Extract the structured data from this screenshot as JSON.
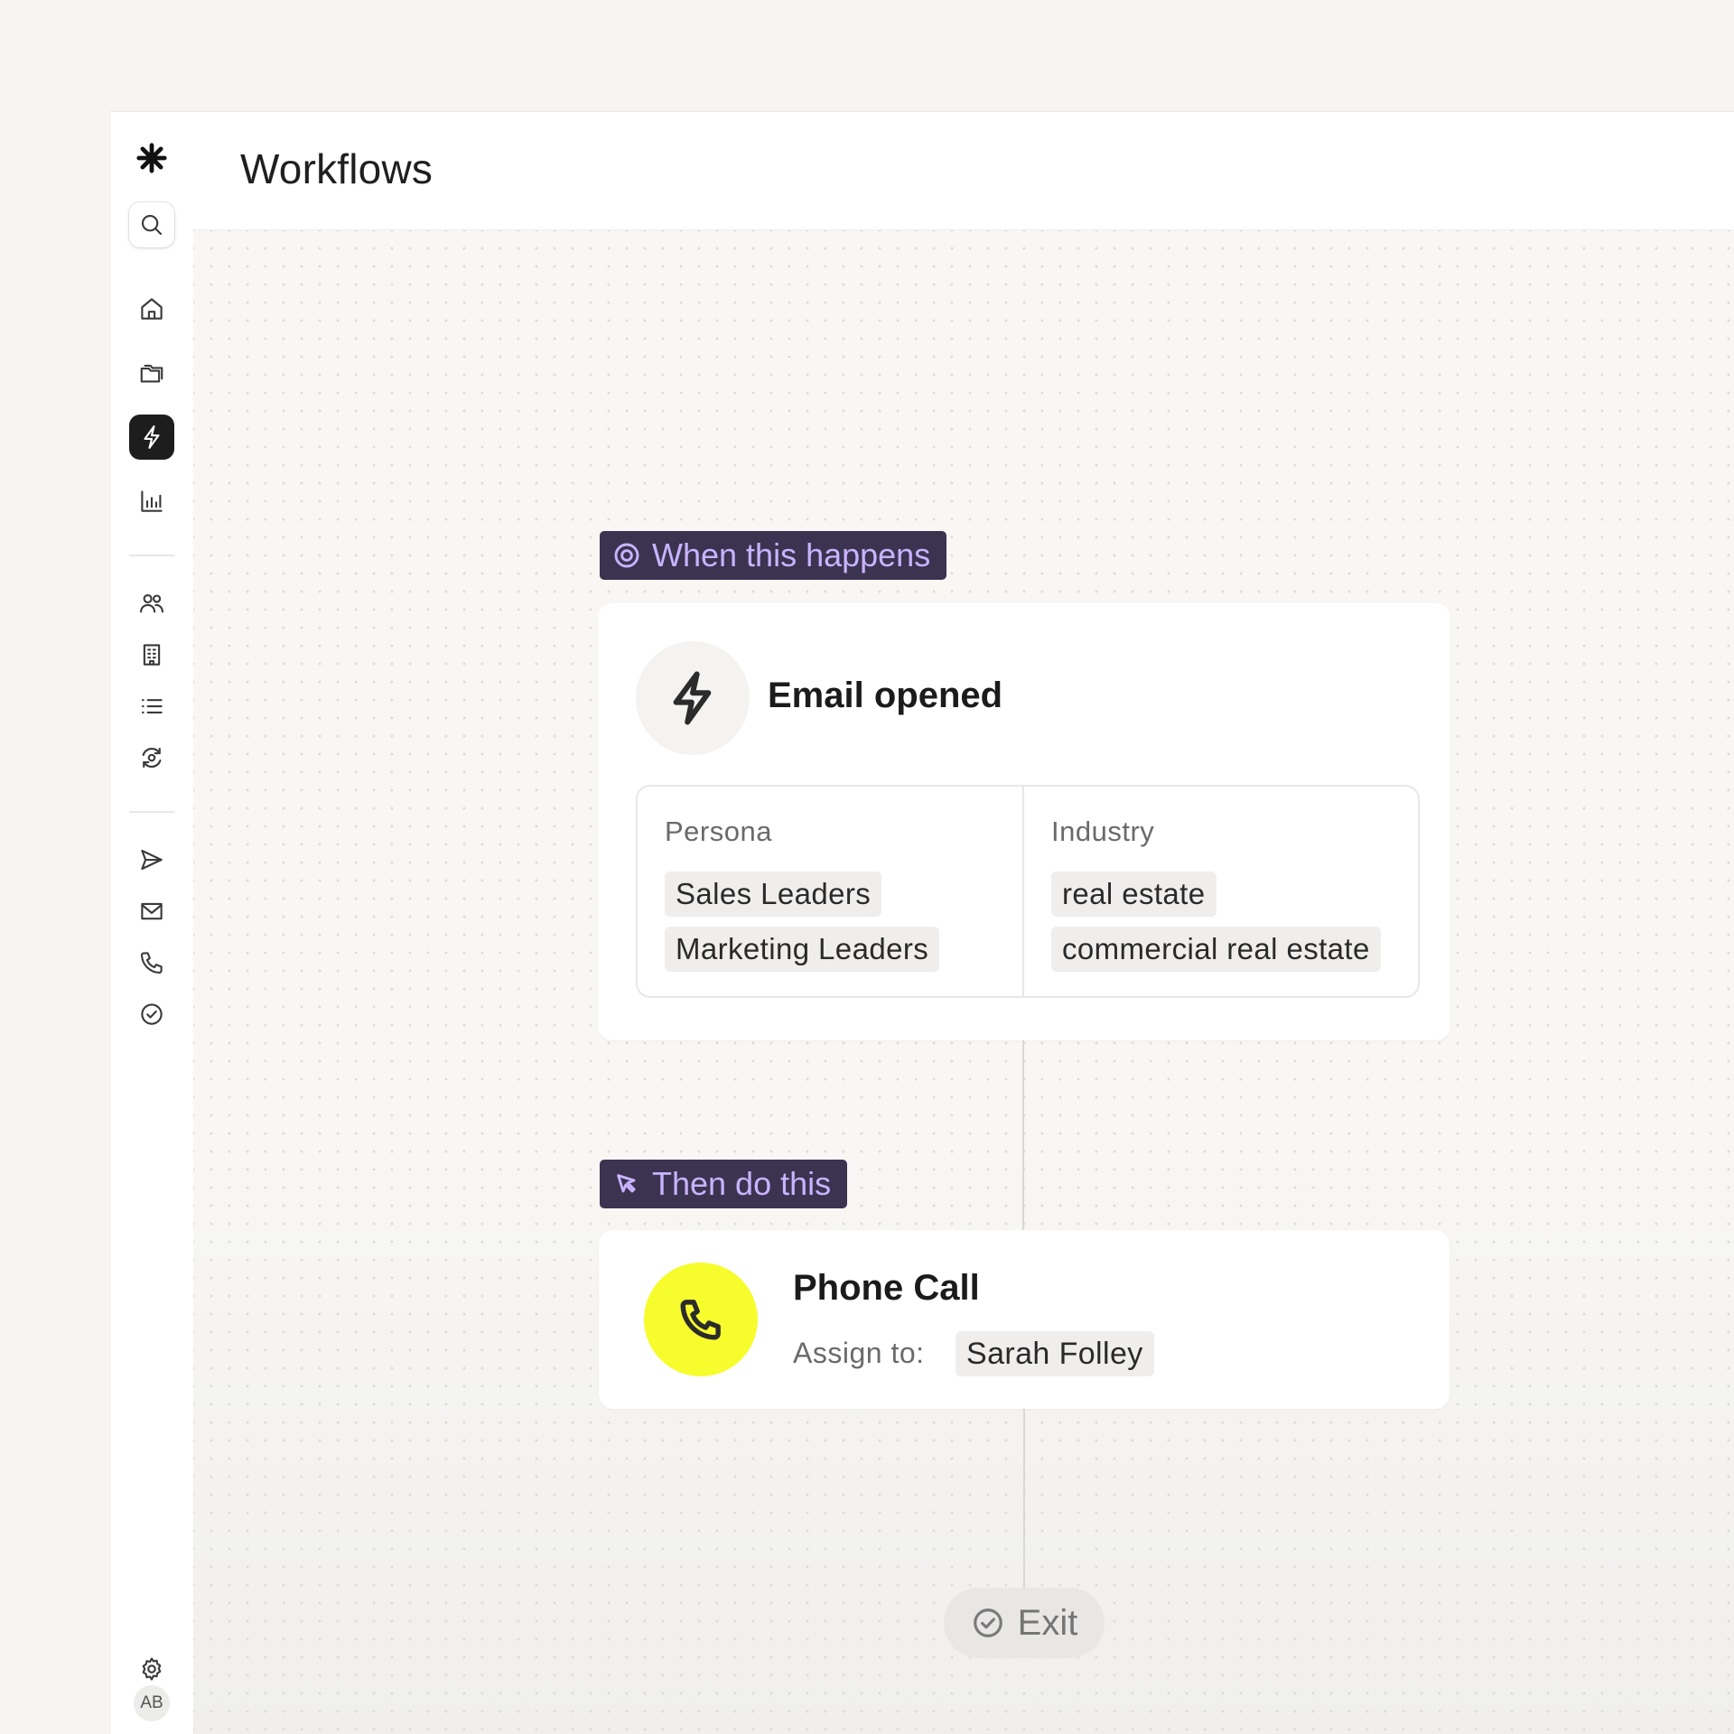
{
  "header": {
    "title": "Workflows"
  },
  "sidebar": {
    "items": [
      {
        "icon": "logo-asterisk-icon"
      },
      {
        "icon": "search-icon"
      },
      {
        "icon": "home-icon"
      },
      {
        "icon": "folders-icon"
      },
      {
        "icon": "lightning-icon",
        "active": true
      },
      {
        "icon": "bar-chart-icon"
      },
      {
        "icon": "people-icon"
      },
      {
        "icon": "building-icon"
      },
      {
        "icon": "list-icon"
      },
      {
        "icon": "sync-icon"
      },
      {
        "icon": "send-icon"
      },
      {
        "icon": "mail-icon"
      },
      {
        "icon": "phone-icon"
      },
      {
        "icon": "check-circle-icon"
      },
      {
        "icon": "settings-icon"
      }
    ],
    "avatar_initials": "AB"
  },
  "workflow": {
    "trigger_tag": "When this happens",
    "trigger": {
      "title": "Email opened",
      "filters": [
        {
          "label": "Persona",
          "values": [
            "Sales Leaders",
            "Marketing Leaders"
          ]
        },
        {
          "label": "Industry",
          "values": [
            "real estate",
            "commercial real estate"
          ]
        }
      ]
    },
    "action_tag": "Then do this",
    "action": {
      "title": "Phone Call",
      "assign_label": "Assign to:",
      "assignee": "Sarah Folley"
    },
    "exit_label": "Exit"
  },
  "colors": {
    "tag_background": "#3b3350",
    "tag_text": "#c9b3ff",
    "action_icon_background": "#f7fc2c",
    "active_nav_background": "#1d1d1d"
  }
}
